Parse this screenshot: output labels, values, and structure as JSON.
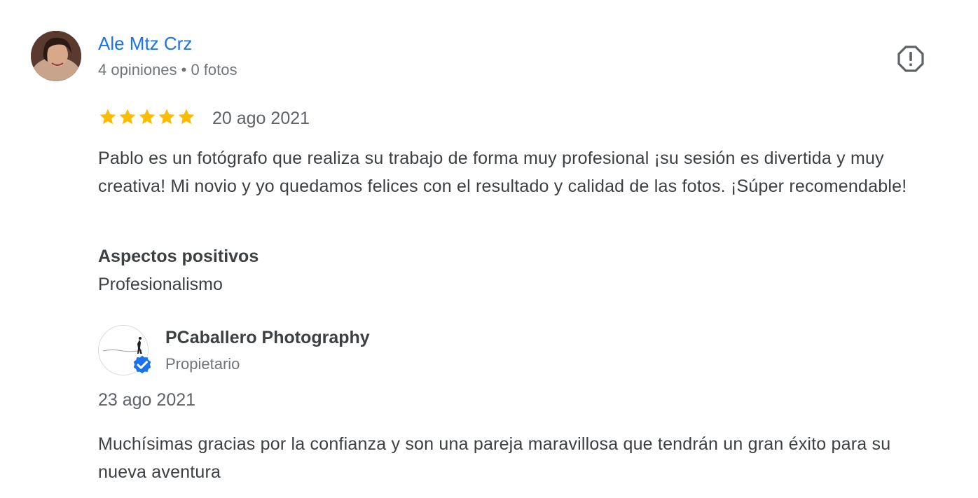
{
  "review": {
    "reviewer_name": "Ale Mtz Crz",
    "reviewer_meta": "4 opiniones • 0 fotos",
    "rating": 5,
    "rating_max": 5,
    "star_color": "#fbbc04",
    "date": "20 ago 2021",
    "text": "Pablo es un fotógrafo que realiza su trabajo de forma muy profesional ¡su sesión es divertida y muy creativa! Mi novio y yo quedamos felices con el resultado y calidad de las fotos. ¡Súper recomendable!",
    "aspects_title": "Aspectos positivos",
    "aspects_value": "Profesionalismo",
    "flag_icon": "report-flag-icon"
  },
  "reply": {
    "owner_name": "PCaballero Photography",
    "owner_role": "Propietario",
    "date": "23 ago 2021",
    "text": "Muchísimas gracias por la confianza y son una pareja maravillosa que tendrán un gran éxito para su nueva aventura",
    "verified_icon": "verified-check-icon"
  },
  "colors": {
    "link": "#1a73e8",
    "text": "#3c4043",
    "secondary": "#70757a",
    "verified": "#1a73e8"
  }
}
